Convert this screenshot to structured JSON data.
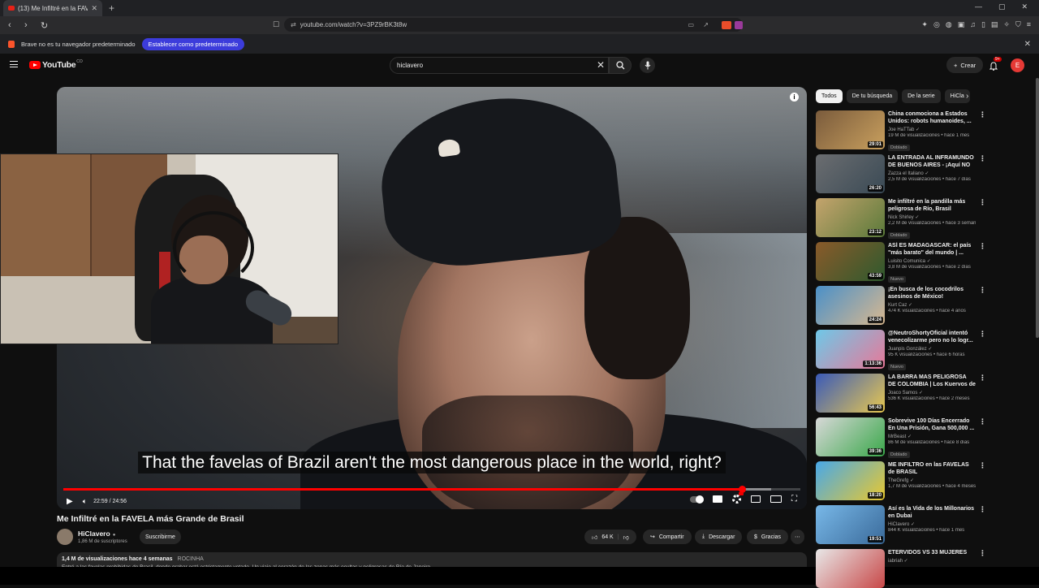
{
  "browser": {
    "tab_title": "(13) Me Infiltré en la FAVELA más",
    "url": "youtube.com/watch?v=3PZ9rBK3t8w",
    "infobar_text": "Brave no es tu navegador predeterminado",
    "infobar_button": "Establecer como predeterminado"
  },
  "header": {
    "logo": "YouTube",
    "logo_region": "CO",
    "search_value": "hiclavero",
    "create_label": "Crear",
    "notif_count": "9+",
    "avatar_letter": "E"
  },
  "player": {
    "subtitle": "That the favelas of Brazil aren't the most dangerous place in the world, right?",
    "time": "22:59 / 24:56",
    "progress_fraction": 0.921,
    "loaded_fraction": 0.96
  },
  "video": {
    "title": "Me Infiltré en la FAVELA más Grande de Brasil",
    "channel": "HiClavero",
    "subscribers": "1,86 M de suscriptores",
    "subscribe_label": "Suscribirme",
    "likes": "64 K",
    "share_label": "Compartir",
    "download_label": "Descargar",
    "thanks_label": "Gracias",
    "views_date": "1,4 M de visualizaciones  hace 4 semanas",
    "tag": "ROCINHA",
    "desc_line": "Entré a las favelas prohibidas de Brasil, donde grabar está estrictamente vetado. Un viaje al corazón de las zonas más ocultas y peligrosas de Río de Janeiro"
  },
  "chips": [
    "Todos",
    "De tu búsqueda",
    "De la serie",
    "HiCla"
  ],
  "recommendations": [
    {
      "title": "China conmociona a Estados Unidos: robots humanoides, ...",
      "channel": "Joe HaTTab",
      "stats": "19 M de visualizaciones • hace 1 mes",
      "badge": "Doblado",
      "duration": "29:01",
      "thumb_colors": [
        "#7a5b3c",
        "#c9a05e"
      ]
    },
    {
      "title": "LA ENTRADA AL INFRAMUNDO DE BUENOS AIRES - ¡Aquí NO ...",
      "channel": "Zazza el Italiano",
      "stats": "2,5 M de visualizaciones • hace 7 días",
      "badge": "",
      "duration": "26:20",
      "thumb_colors": [
        "#6b6d70",
        "#3a4a55"
      ]
    },
    {
      "title": "Me infiltré en la pandilla más peligrosa de Río, Brasil",
      "channel": "Nick Shirley",
      "stats": "2,2 M de visualizaciones • hace 3 seman...",
      "badge": "Doblado",
      "duration": "23:12",
      "thumb_colors": [
        "#c5a46d",
        "#5a7a3a"
      ]
    },
    {
      "title": "ASÍ ES MADAGASCAR: el país \"más barato\" del mundo | ...",
      "channel": "Luisito Comunica",
      "stats": "3,8 M de visualizaciones • hace 2 días",
      "badge": "Nuevo",
      "duration": "43:59",
      "thumb_colors": [
        "#8a5a2a",
        "#2e5a2e"
      ]
    },
    {
      "title": "¡En busca de los cocodrilos asesinos de México!",
      "channel": "Kurt Caz",
      "stats": "474 K visualizaciones • hace 4 años",
      "badge": "",
      "duration": "24:24",
      "thumb_colors": [
        "#4a90c8",
        "#d8b890"
      ]
    },
    {
      "title": "@NeutroShortyOficial intentó venecolizarme pero no lo logr...",
      "channel": "Juanpis González",
      "stats": "95 K visualizaciones • hace 6 horas",
      "badge": "Nuevo",
      "duration": "1:13:36",
      "thumb_colors": [
        "#6ec8e8",
        "#e87898"
      ]
    },
    {
      "title": "LA BARRA MAS PELIGROSA DE COLOMBIA | Los Kuervos de ...",
      "channel": "Joaco Samos",
      "stats": "536 K visualizaciones • hace 2 meses",
      "badge": "",
      "duration": "56:43",
      "thumb_colors": [
        "#3a5ab8",
        "#e8c850"
      ]
    },
    {
      "title": "Sobrevive 100 Días Encerrado En Una Prisión, Gana 500,000 ...",
      "channel": "MrBeast",
      "stats": "86 M de visualizaciones • hace 8 días",
      "badge": "Doblado",
      "duration": "39:36",
      "thumb_colors": [
        "#d8d8d8",
        "#3aa84a"
      ]
    },
    {
      "title": "ME INFILTRO en las FAVELAS de BRASIL",
      "channel": "TheGrefg",
      "stats": "1,7 M de visualizaciones • hace 4 meses",
      "badge": "",
      "duration": "18:20",
      "thumb_colors": [
        "#48a8e8",
        "#e8c830"
      ]
    },
    {
      "title": "Así es la Vida de los Millonarios en Dubai",
      "channel": "HiClavero",
      "stats": "844 K visualizaciones • hace 1 mes",
      "badge": "",
      "duration": "19:51",
      "thumb_colors": [
        "#78b8e8",
        "#3a6a9a"
      ]
    },
    {
      "title": "ETERVIDOS VS 33 MUJERES",
      "channel": "iabriah",
      "stats": "",
      "badge": "",
      "duration": "",
      "thumb_colors": [
        "#e8e8e8",
        "#c84848"
      ]
    }
  ]
}
